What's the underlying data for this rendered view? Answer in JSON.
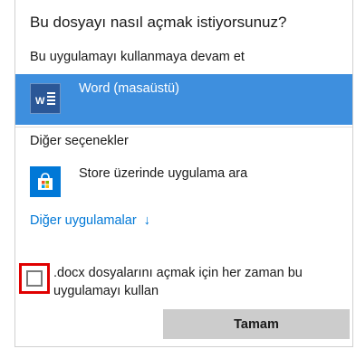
{
  "dialog": {
    "title": "Bu dosyayı nasıl açmak istiyorsunuz?",
    "subtitle": "Bu uygulamayı kullanmaya devam et",
    "selected_app": {
      "label": "Word (masaüstü)",
      "icon": "word-icon"
    },
    "other_options_label": "Diğer seçenekler",
    "store_option": {
      "label": "Store üzerinde uygulama ara",
      "icon": "store-icon"
    },
    "more_apps_link": "Diğer uygulamalar",
    "more_apps_arrow": "↓",
    "always_use_checkbox": {
      "label": ".docx dosyalarını açmak için her zaman bu uygulamayı kullan",
      "checked": false
    },
    "ok_button": "Tamam"
  },
  "colors": {
    "selected_bg": "#3e8fde",
    "word_blue": "#2b5797",
    "store_blue": "#0078d7",
    "link": "#0078d7",
    "highlight_red": "#e00000",
    "button_bg": "#cccccc"
  }
}
